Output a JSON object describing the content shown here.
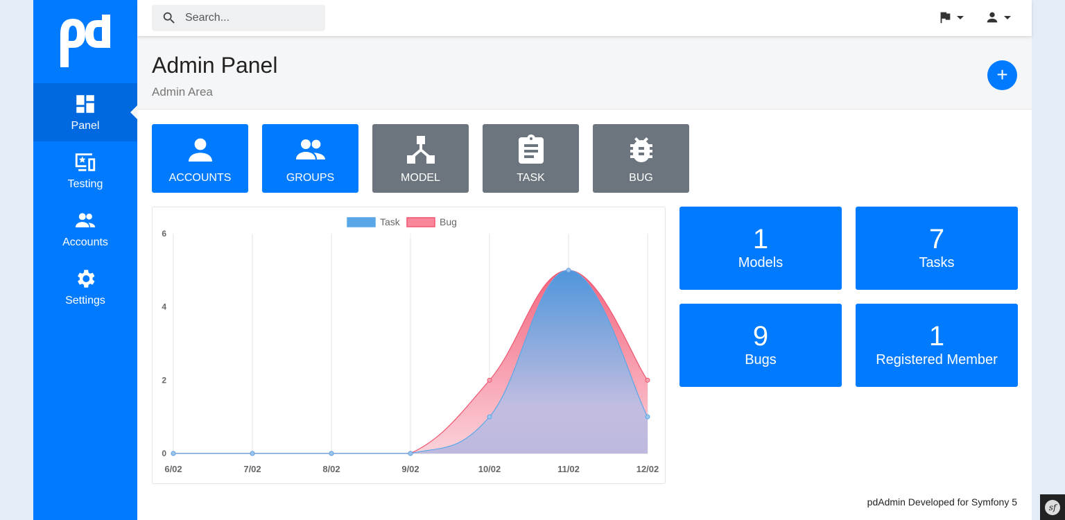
{
  "sidebar": {
    "logo": "pd",
    "items": [
      {
        "label": "Panel",
        "icon": "dashboard-icon",
        "active": true
      },
      {
        "label": "Testing",
        "icon": "testing-devices-icon"
      },
      {
        "label": "Accounts",
        "icon": "users-icon"
      },
      {
        "label": "Settings",
        "icon": "gear-icon"
      }
    ]
  },
  "topbar": {
    "search_placeholder": "Search...",
    "icons": [
      "flag-icon",
      "user-icon"
    ]
  },
  "header": {
    "title": "Admin Panel",
    "subtitle": "Admin Area",
    "add_button": "+"
  },
  "tiles": [
    {
      "label": "ACCOUNTS",
      "icon": "user-icon",
      "color": "#007bff"
    },
    {
      "label": "GROUPS",
      "icon": "group-icon",
      "color": "#007bff"
    },
    {
      "label": "MODEL",
      "icon": "hierarchy-icon",
      "color": "#6c757d"
    },
    {
      "label": "TASK",
      "icon": "clipboard-icon",
      "color": "#6c757d"
    },
    {
      "label": "BUG",
      "icon": "bug-icon",
      "color": "#6c757d"
    }
  ],
  "chart_data": {
    "type": "area",
    "categories": [
      "6/02",
      "7/02",
      "8/02",
      "9/02",
      "10/02",
      "11/02",
      "12/02"
    ],
    "series": [
      {
        "name": "Task",
        "values": [
          0,
          0,
          0,
          0,
          1,
          5,
          1
        ],
        "color": "#5aa7e8"
      },
      {
        "name": "Bug",
        "values": [
          0,
          0,
          0,
          0,
          2,
          5,
          2
        ],
        "color": "#f0556f"
      }
    ],
    "yticks": [
      "0",
      "2",
      "4",
      "6"
    ],
    "ylim": [
      0,
      6
    ],
    "grid": true,
    "legend": "top"
  },
  "stats": [
    {
      "number": "1",
      "label": "Models"
    },
    {
      "number": "7",
      "label": "Tasks"
    },
    {
      "number": "9",
      "label": "Bugs"
    },
    {
      "number": "1",
      "label": "Registered Member"
    }
  ],
  "footer": "pdAdmin Developed for Symfony 5",
  "symfony_badge": "sf"
}
